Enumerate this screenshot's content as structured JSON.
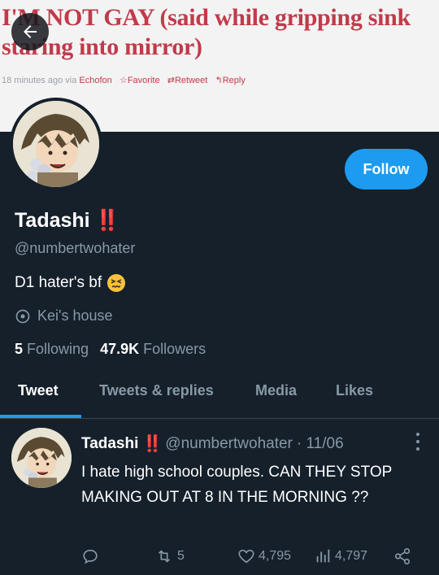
{
  "header_tweet": {
    "text": "I'M NOT GAY (said while gripping sink staring into mirror)",
    "meta_time": "18 minutes ago via",
    "meta_client": "Echofon",
    "favorite_label": "Favorite",
    "retweet_label": "Retweet",
    "reply_label": "Reply"
  },
  "profile": {
    "name": "Tadashi",
    "name_emoji": "‼️",
    "handle": "@numbertwohater",
    "bio": "D1 hater's bf",
    "bio_emoji": "persevering-face",
    "location": "Kei's house",
    "following_count": "5",
    "following_label": "Following",
    "followers_count": "47.9K",
    "followers_label": "Followers",
    "follow_button": "Follow"
  },
  "tabs": [
    {
      "label": "Tweet",
      "active": true
    },
    {
      "label": "Tweets & replies",
      "active": false
    },
    {
      "label": "Media",
      "active": false
    },
    {
      "label": "Likes",
      "active": false
    }
  ],
  "tweet": {
    "name": "Tadashi",
    "handle": "@numbertwohater",
    "date": "· 11/06",
    "text": "I hate high school couples. CAN THEY STOP MAKING OUT AT 8 IN THE MORNING ??",
    "retweets": "5",
    "likes": "4,795",
    "views": "4,797"
  },
  "colors": {
    "background": "#15202b",
    "accent": "#1d9bf0",
    "muted": "#8899a6",
    "alert_red": "#e0242f"
  }
}
